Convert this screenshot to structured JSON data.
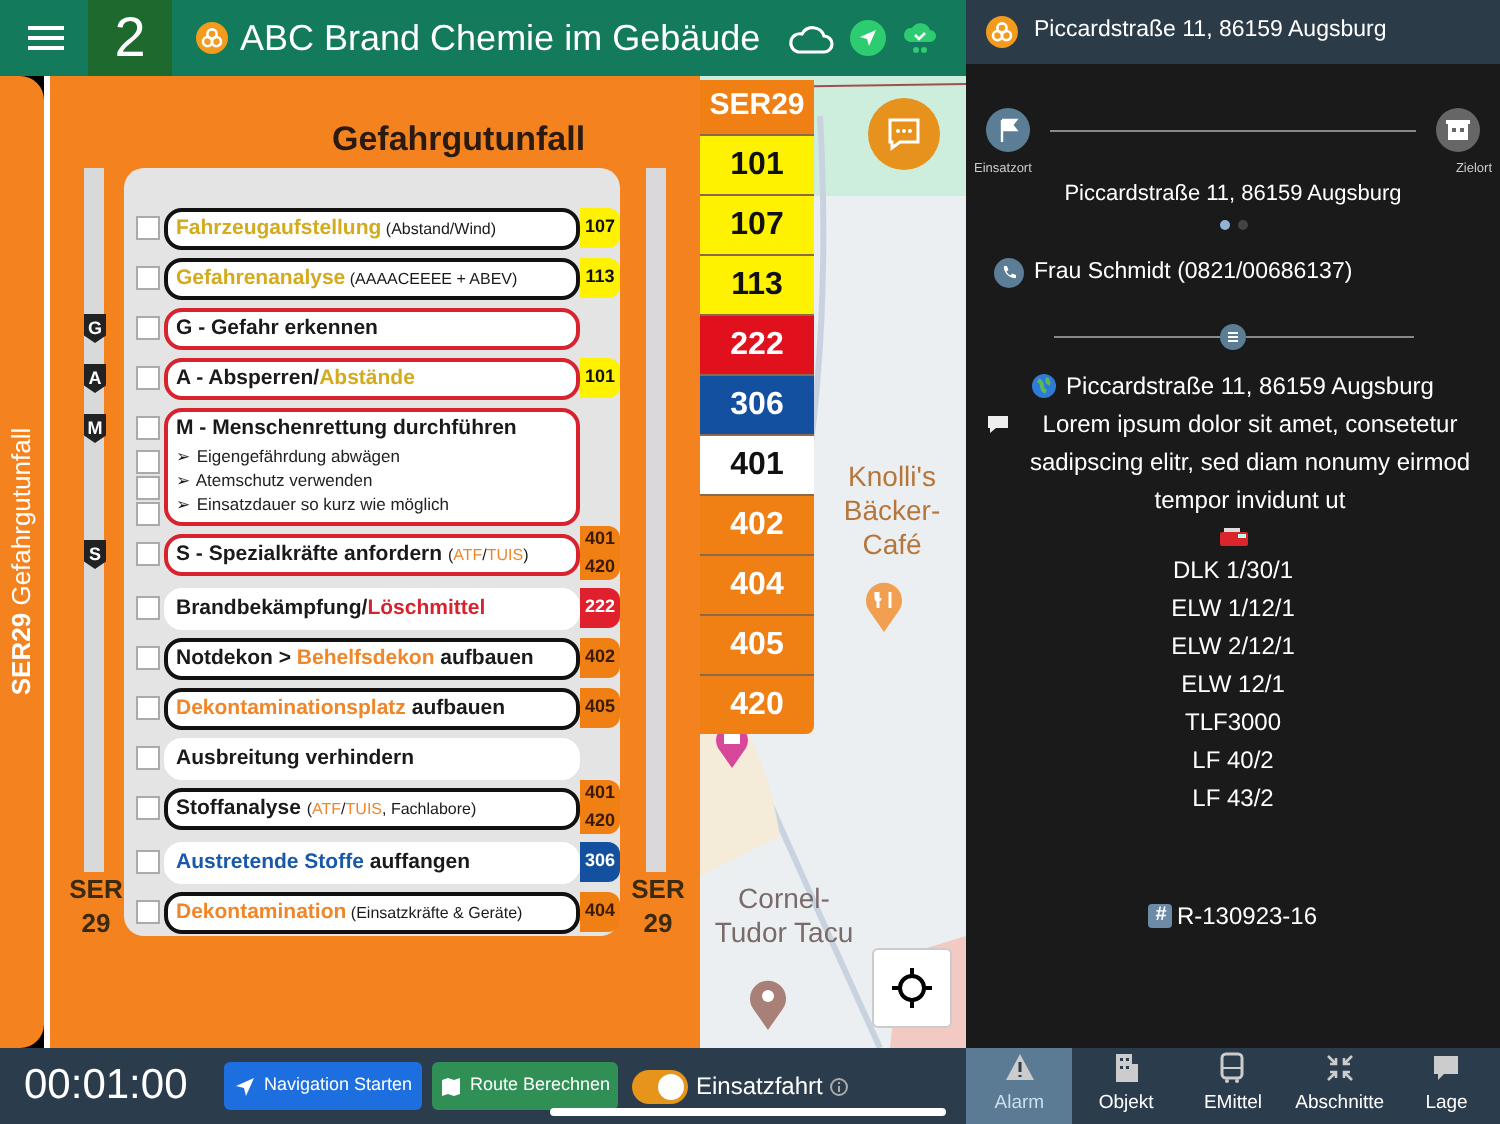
{
  "top_bar": {
    "unit_number": "2",
    "title": "ABC Brand Chemie im Gebäude"
  },
  "side_tab": {
    "label": "**SER29** Gefahrgutunfall"
  },
  "checklist": {
    "title": "Gefahrgutunfall",
    "footer_left": "SER 29",
    "footer_right": "SER 29",
    "items": [
      {
        "checked": false,
        "outlined": true,
        "color": "#111111",
        "segments": [
          {
            "text": "Fahrzeugaufstellung",
            "kind": "gold"
          },
          {
            "text": " (Abstand/Wind)",
            "kind": "note"
          }
        ],
        "codes": [
          {
            "text": "107",
            "color": "#fff200"
          }
        ]
      },
      {
        "checked": false,
        "outlined": true,
        "color": "#111111",
        "segments": [
          {
            "text": "Gefahrenanalyse",
            "kind": "gold"
          },
          {
            "text": " (AAAACEEEE + ABEV)",
            "kind": "note"
          }
        ],
        "codes": [
          {
            "text": "113",
            "color": "#fff200"
          }
        ]
      },
      {
        "checked": false,
        "outlined": true,
        "color": "#d8222e",
        "marker": "G",
        "segments": [
          {
            "text": "G - Gefahr erkennen",
            "kind": "plain"
          }
        ]
      },
      {
        "checked": false,
        "outlined": true,
        "color": "#d8222e",
        "marker": "A",
        "segments": [
          {
            "text": "A - Absperren/",
            "kind": "plain"
          },
          {
            "text": "Abstände",
            "kind": "gold"
          }
        ],
        "codes": [
          {
            "text": "101",
            "color": "#fff200"
          }
        ]
      },
      {
        "checked": false,
        "outlined": true,
        "color": "#d8222e",
        "marker": "M",
        "segments": [
          {
            "text": "M - Menschenrettung durchführen",
            "kind": "plain"
          }
        ],
        "subitems": [
          {
            "text": "➢ Eigengefährdung abwägen",
            "checked": false
          },
          {
            "text": "➢ Atemschutz verwenden",
            "checked": false
          },
          {
            "text": "➢ Einsatzdauer so kurz wie möglich",
            "checked": false
          }
        ]
      },
      {
        "checked": false,
        "outlined": true,
        "color": "#d8222e",
        "marker": "S",
        "segments": [
          {
            "text": "S - Spezialkräfte anfordern ",
            "kind": "plain"
          },
          {
            "text": "(",
            "kind": "note"
          },
          {
            "text": "ATF",
            "kind": "orange-note"
          },
          {
            "text": "/",
            "kind": "note"
          },
          {
            "text": "TUIS",
            "kind": "orange-note"
          },
          {
            "text": ")",
            "kind": "note"
          }
        ],
        "codes": [
          {
            "text": "401",
            "color": "#f07f14"
          },
          {
            "text": "420",
            "color": "#f07f14"
          }
        ]
      },
      {
        "checked": false,
        "outlined": false,
        "segments": [
          {
            "text": "Brandbekämpfung/",
            "kind": "plain"
          },
          {
            "text": "Löschmittel",
            "kind": "red"
          }
        ],
        "codes": [
          {
            "text": "222",
            "color": "#e0202c"
          }
        ]
      },
      {
        "checked": false,
        "outlined": true,
        "color": "#111111",
        "segments": [
          {
            "text": "Notdekon > ",
            "kind": "plain"
          },
          {
            "text": "Behelfsdekon",
            "kind": "orange"
          },
          {
            "text": " aufbauen",
            "kind": "plain"
          }
        ],
        "codes": [
          {
            "text": "402",
            "color": "#f07f14"
          }
        ]
      },
      {
        "checked": false,
        "outlined": true,
        "color": "#111111",
        "segments": [
          {
            "text": "Dekontaminationsplatz",
            "kind": "orange"
          },
          {
            "text": " aufbauen",
            "kind": "plain"
          }
        ],
        "codes": [
          {
            "text": "405",
            "color": "#f07f14"
          }
        ]
      },
      {
        "checked": false,
        "outlined": false,
        "segments": [
          {
            "text": "Ausbreitung verhindern",
            "kind": "plain"
          }
        ]
      },
      {
        "checked": false,
        "outlined": true,
        "color": "#111111",
        "segments": [
          {
            "text": "Stoffanalyse ",
            "kind": "plain"
          },
          {
            "text": "(",
            "kind": "note"
          },
          {
            "text": "ATF",
            "kind": "orange-note"
          },
          {
            "text": "/",
            "kind": "note"
          },
          {
            "text": "TUIS",
            "kind": "orange-note"
          },
          {
            "text": ", Fachlabore)",
            "kind": "note"
          }
        ],
        "codes": [
          {
            "text": "401",
            "color": "#f07f14"
          },
          {
            "text": "420",
            "color": "#f07f14"
          }
        ]
      },
      {
        "checked": false,
        "outlined": false,
        "segments": [
          {
            "text": "Austretende Stoffe",
            "kind": "blue"
          },
          {
            "text": " auffangen",
            "kind": "plain"
          }
        ],
        "codes": [
          {
            "text": "306",
            "color": "#1450a0"
          }
        ]
      },
      {
        "checked": false,
        "outlined": true,
        "color": "#111111",
        "segments": [
          {
            "text": "Dekontamination",
            "kind": "orange"
          },
          {
            "text": " (Einsatzkräfte & Geräte)",
            "kind": "note"
          }
        ],
        "codes": [
          {
            "text": "404",
            "color": "#f07f14"
          }
        ]
      }
    ]
  },
  "code_column": {
    "header": "SER29",
    "codes": [
      {
        "text": "101",
        "color": "#fff200"
      },
      {
        "text": "107",
        "color": "#fff200"
      },
      {
        "text": "113",
        "color": "#fff200"
      },
      {
        "text": "222",
        "color": "#e0101c"
      },
      {
        "text": "306",
        "color": "#1450a0"
      },
      {
        "text": "401",
        "color": "#ffffff"
      },
      {
        "text": "402",
        "color": "#f07f14"
      },
      {
        "text": "404",
        "color": "#f07f14"
      },
      {
        "text": "405",
        "color": "#f07f14"
      },
      {
        "text": "420",
        "color": "#f07f14"
      }
    ]
  },
  "map": {
    "labels": [
      "Knolli's Bäcker-Café",
      "Cornel-Tudor Tacu"
    ]
  },
  "panel": {
    "header": "Piccardstraße 11, 86159 Augsburg",
    "route": {
      "start_label": "Einsatzort",
      "end_label": "Zielort",
      "address": "Piccardstraße 11, 86159 Augsburg",
      "pages": [
        {
          "selected": true
        },
        {
          "selected": false
        }
      ]
    },
    "contact": "Frau Schmidt (0821/00686137)",
    "info": [
      {
        "kind": "globe",
        "text": "Piccardstraße 11, 86159 Augsburg"
      },
      {
        "kind": "comment",
        "text": "Lorem ipsum dolor sit amet, consetetur sadipscing elitr, sed diam nonumy eirmod tempor invidunt ut"
      }
    ],
    "vehicles": [
      "DLK 1/30/1",
      "ELW 1/12/1",
      "ELW 2/12/1",
      "ELW 12/1",
      "TLF3000",
      "LF 40/2",
      "LF 43/2"
    ],
    "tag": {
      "symbol": "#",
      "text": "R-130923-16"
    }
  },
  "bottom_bar": {
    "timer": "00:01:00",
    "buttons": [
      {
        "kind": "navigate",
        "label": "Navigation Starten"
      },
      {
        "kind": "route",
        "label": "Route Berechnen"
      }
    ],
    "toggle": {
      "label": "Einsatzfahrt",
      "on": true
    },
    "tabs": [
      {
        "kind": "alarm",
        "label": "Alarm",
        "selected": true
      },
      {
        "kind": "object",
        "label": "Objekt",
        "selected": false
      },
      {
        "kind": "vehicle",
        "label": "EMittel",
        "selected": false
      },
      {
        "kind": "sections",
        "label": "Abschnitte",
        "selected": false
      },
      {
        "kind": "situation",
        "label": "Lage",
        "selected": false
      }
    ]
  }
}
